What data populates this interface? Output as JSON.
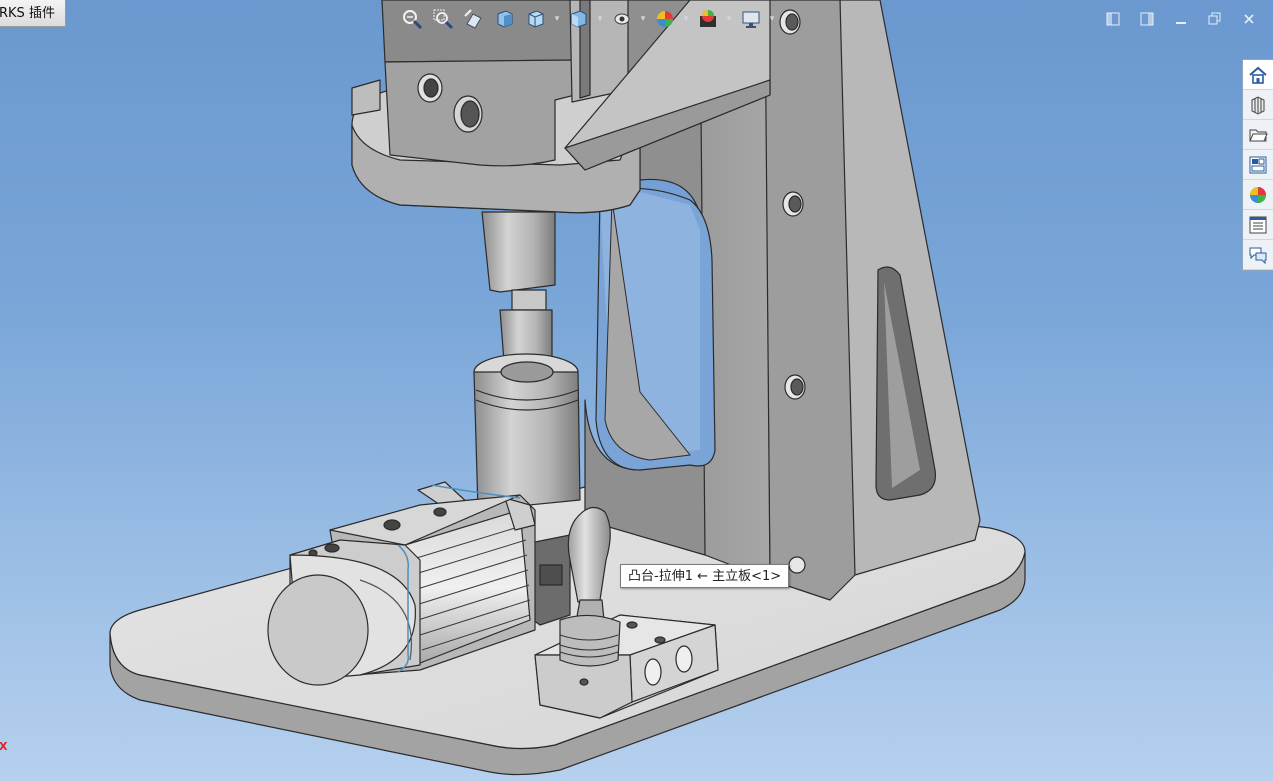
{
  "app": {
    "addins_tab_label": "RKS 插件"
  },
  "hud_toolbar": {
    "buttons": [
      {
        "name": "zoom-to-fit-icon"
      },
      {
        "name": "zoom-to-area-icon"
      },
      {
        "name": "previous-view-icon"
      },
      {
        "name": "section-view-icon"
      },
      {
        "name": "view-orientation-icon"
      },
      {
        "name": "display-style-icon"
      },
      {
        "name": "hide-show-items-icon"
      },
      {
        "name": "edit-appearance-icon"
      },
      {
        "name": "apply-scene-icon"
      },
      {
        "name": "view-settings-icon"
      }
    ]
  },
  "window_controls": {
    "buttons": [
      {
        "name": "tile-left-icon"
      },
      {
        "name": "tile-right-icon"
      },
      {
        "name": "minimize-icon"
      },
      {
        "name": "restore-icon"
      },
      {
        "name": "close-icon"
      }
    ]
  },
  "task_pane": {
    "items": [
      {
        "name": "solidworks-resources-icon",
        "active": true
      },
      {
        "name": "design-library-icon"
      },
      {
        "name": "file-explorer-icon"
      },
      {
        "name": "view-palette-icon"
      },
      {
        "name": "appearances-scenes-icon"
      },
      {
        "name": "custom-properties-icon"
      },
      {
        "name": "forum-icon"
      }
    ]
  },
  "tooltip": {
    "text": "凸台-拉伸1 ← 主立板<1>"
  },
  "triad": {
    "x_label": "X"
  },
  "colors": {
    "background_top": "#6a98cf",
    "background_bottom": "#b6d0ee",
    "part_gray": "#a9a9a9",
    "edge_dark": "#2b2b2b",
    "triad_red": "#e0222a"
  }
}
